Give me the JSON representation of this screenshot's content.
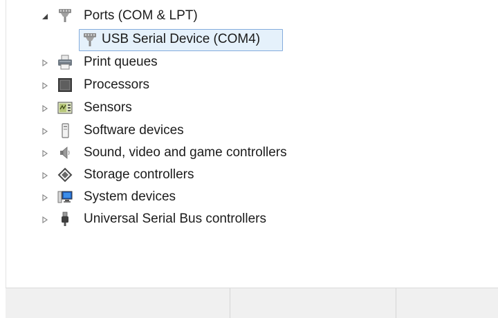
{
  "tree": {
    "ports": {
      "label": "Ports (COM & LPT)",
      "icon": "port-connector-icon",
      "expanded": true
    },
    "usb_serial": {
      "label": "USB Serial Device (COM4)",
      "icon": "port-connector-icon",
      "selected": true
    },
    "print_queues": {
      "label": "Print queues",
      "icon": "printer-icon"
    },
    "processors": {
      "label": "Processors",
      "icon": "processor-chip-icon"
    },
    "sensors": {
      "label": "Sensors",
      "icon": "sensor-icon"
    },
    "software_devices": {
      "label": "Software devices",
      "icon": "software-device-icon"
    },
    "sound": {
      "label": "Sound, video and game controllers",
      "icon": "speaker-icon"
    },
    "storage": {
      "label": "Storage controllers",
      "icon": "storage-controller-icon"
    },
    "system_devices": {
      "label": "System devices",
      "icon": "computer-monitor-icon"
    },
    "usb_controllers": {
      "label": "Universal Serial Bus controllers",
      "icon": "usb-plug-icon"
    }
  },
  "colors": {
    "selection_border": "#84acdd",
    "selection_fill": "#e5f1fb",
    "status_bar": "#f0f0f0"
  }
}
